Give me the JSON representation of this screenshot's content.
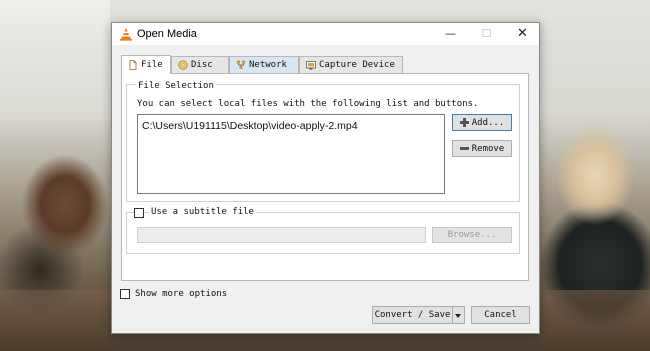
{
  "window": {
    "title": "Open Media",
    "controls": {
      "minimize": "—",
      "maximize": "☐",
      "close": "✕"
    }
  },
  "tabs": [
    {
      "label": "File",
      "icon": "file-icon",
      "active": true
    },
    {
      "label": "Disc",
      "icon": "disc-icon",
      "active": false
    },
    {
      "label": "Network",
      "icon": "network-icon",
      "active": false
    },
    {
      "label": "Capture Device",
      "icon": "capture-device-icon",
      "active": false
    }
  ],
  "file_selection": {
    "legend": "File Selection",
    "hint": "You can select local files with the following list and buttons.",
    "files": [
      "C:\\Users\\U191115\\Desktop\\video-apply-2.mp4"
    ],
    "add_label": "Add...",
    "remove_label": "Remove"
  },
  "subtitle": {
    "checkbox_label": "Use a subtitle file",
    "checked": false,
    "path_value": "",
    "browse_label": "Browse..."
  },
  "options": {
    "show_more_label": "Show more options",
    "checked": false
  },
  "footer": {
    "convert_label": "Convert / Save",
    "cancel_label": "Cancel"
  },
  "colors": {
    "accent_border": "#3c7fb1",
    "network_tab_hover": "#d8e6f3",
    "vlc_orange": "#f07b12"
  }
}
